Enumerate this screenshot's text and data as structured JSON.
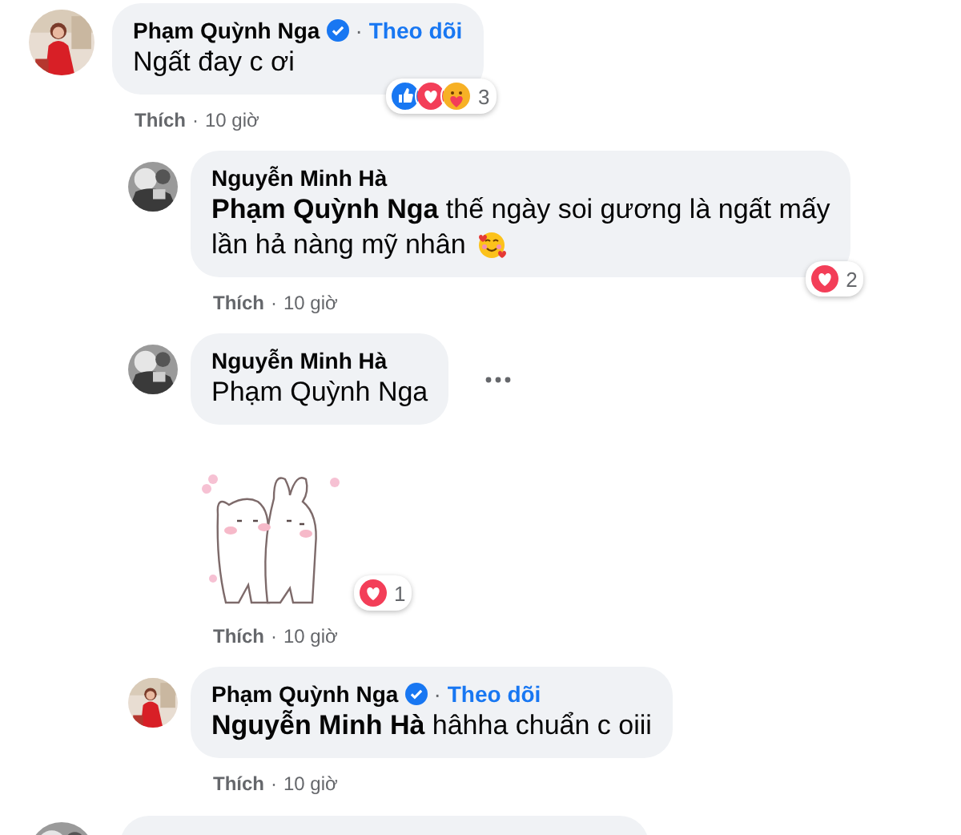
{
  "comment": {
    "author": "Phạm Quỳnh Nga",
    "verified": true,
    "dot": "·",
    "follow": "Theo dõi",
    "lines": [
      "Ngất đay c ơi"
    ],
    "reactions": {
      "icons": [
        {
          "kind": "like"
        },
        {
          "kind": "love"
        },
        {
          "kind": "care"
        }
      ],
      "count": "3"
    },
    "actions": {
      "like": "Thích",
      "dot": "·",
      "time": "10 giờ"
    },
    "replies": [
      {
        "author": "Nguyễn Minh Hà",
        "lines": [
          "**Phạm Quỳnh Nga** thế ngày soi gương là ngất mấy",
          "lần hả nàng mỹ nhân"
        ],
        "emoji": true,
        "reactions": {
          "icons": [
            {
              "kind": "love"
            }
          ],
          "count": "2"
        },
        "actions": {
          "like": "Thích",
          "dot": "·",
          "time": "10 giờ"
        }
      },
      {
        "author": "Nguyễn Minh Hà",
        "lines": [
          "Phạm Quỳnh Nga"
        ],
        "more": true,
        "sticker": true,
        "reactions": {
          "icons": [
            {
              "kind": "love"
            }
          ],
          "count": "1"
        },
        "actions": {
          "like": "Thích",
          "dot": "·",
          "time": "10 giờ"
        }
      },
      {
        "author": "Phạm Quỳnh Nga",
        "verified": true,
        "dot": "·",
        "follow": "Theo dõi",
        "lines": [
          "**Nguyễn Minh Hà** hâhha chuẩn c oiii"
        ],
        "actions": {
          "like": "Thích",
          "dot": "·",
          "time": "10 giờ"
        }
      }
    ]
  }
}
